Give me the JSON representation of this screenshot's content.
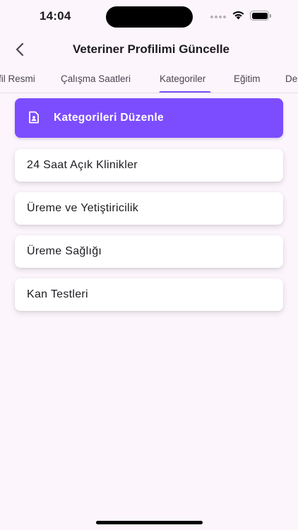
{
  "status_bar": {
    "time": "14:04"
  },
  "header": {
    "title": "Veteriner Profilimi Güncelle"
  },
  "tabs": [
    {
      "label": "Profil Resmi",
      "visible_text": "fil Resmi"
    },
    {
      "label": "Çalışma Saatleri"
    },
    {
      "label": "Kategoriler",
      "active": true
    },
    {
      "label": "Eğitim"
    },
    {
      "label": "De"
    }
  ],
  "actions": {
    "edit_categories_label": "Kategorileri Düzenle"
  },
  "categories": [
    "24 Saat Açık Klinikler",
    "Üreme ve Yetiştiricilik",
    "Üreme Sağlığı",
    "Kan Testleri"
  ],
  "colors": {
    "accent": "#7c4dff",
    "background": "#fcf5fc",
    "card": "#ffffff"
  }
}
